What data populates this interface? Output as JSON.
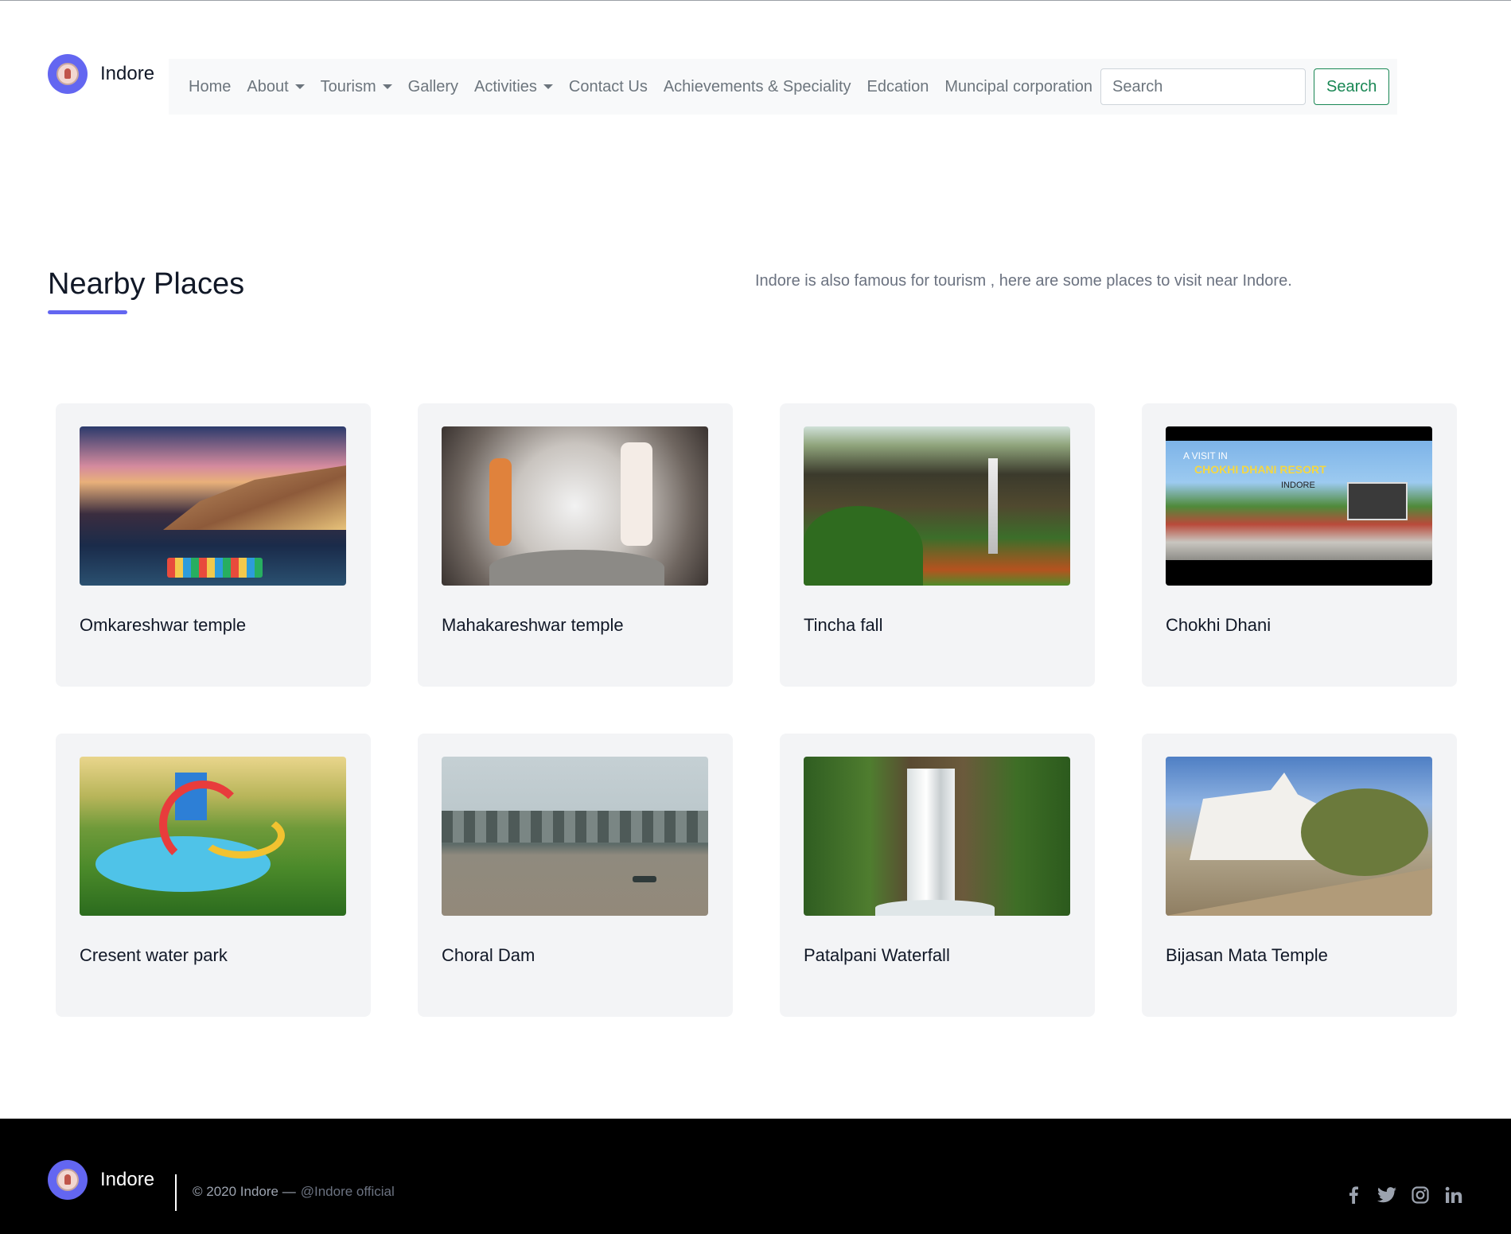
{
  "brand": {
    "name": "Indore"
  },
  "nav": {
    "items": [
      {
        "label": "Home",
        "dropdown": false
      },
      {
        "label": "About",
        "dropdown": true
      },
      {
        "label": "Tourism",
        "dropdown": true
      },
      {
        "label": "Gallery",
        "dropdown": false
      },
      {
        "label": "Activities",
        "dropdown": true
      },
      {
        "label": "Contact Us",
        "dropdown": false
      },
      {
        "label": "Achievements & Speciality",
        "dropdown": false
      },
      {
        "label": "Edcation",
        "dropdown": false
      },
      {
        "label": "Muncipal corporation",
        "dropdown": false
      }
    ],
    "search_placeholder": "Search",
    "search_button": "Search"
  },
  "section": {
    "title": "Nearby Places",
    "description": "Indore is also famous for tourism , here are some places to visit near Indore."
  },
  "places": [
    {
      "name": "Omkareshwar temple"
    },
    {
      "name": "Mahakareshwar temple"
    },
    {
      "name": "Tincha fall"
    },
    {
      "name": "Chokhi Dhani",
      "image_text": [
        "A VISIT IN",
        "CHOKHI DHANI RESORT",
        "INDORE"
      ]
    },
    {
      "name": "Cresent water park"
    },
    {
      "name": "Choral Dam"
    },
    {
      "name": "Patalpani Waterfall"
    },
    {
      "name": "Bijasan Mata Temple"
    }
  ],
  "footer": {
    "brand": "Indore",
    "copyright": "© 2020 Indore —",
    "handle": "@Indore official",
    "social_icons": [
      "facebook-icon",
      "twitter-icon",
      "instagram-icon",
      "linkedin-icon"
    ]
  },
  "colors": {
    "accent": "#6366f1",
    "card_bg": "#f3f4f6",
    "search_button": "#198754",
    "footer_bg": "#000000"
  }
}
